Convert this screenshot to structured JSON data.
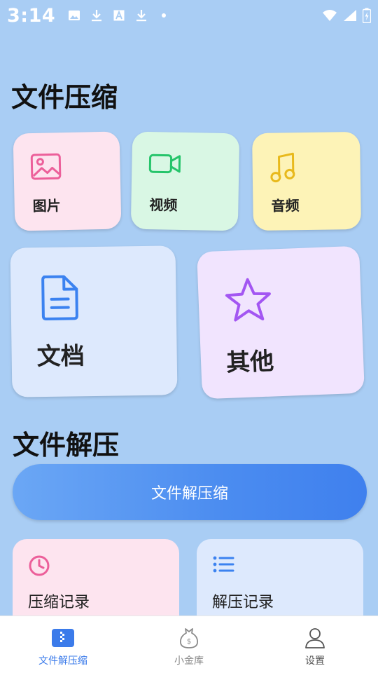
{
  "status_bar": {
    "time": "3:14",
    "icons": [
      "image-icon",
      "download-icon",
      "font-a-icon",
      "download-icon",
      "dot-icon"
    ],
    "right_icons": [
      "wifi-icon",
      "signal-icon",
      "battery-charging-icon"
    ]
  },
  "compress_section": {
    "title": "文件压缩",
    "cards": [
      {
        "label": "图片",
        "icon": "image-icon",
        "color": "#fde4ef",
        "icon_color": "#ec5f9a"
      },
      {
        "label": "视频",
        "icon": "video-icon",
        "color": "#d9f7e4",
        "icon_color": "#25c46a"
      },
      {
        "label": "音频",
        "icon": "music-icon",
        "color": "#fdf3b7",
        "icon_color": "#e8b91c"
      },
      {
        "label": "文档",
        "icon": "document-icon",
        "color": "#dde9fd",
        "icon_color": "#3b82f0"
      },
      {
        "label": "其他",
        "icon": "star-icon",
        "color": "#f1e4fe",
        "icon_color": "#a356f2"
      }
    ]
  },
  "decompress_section": {
    "title": "文件解压",
    "button_label": "文件解压缩"
  },
  "records": [
    {
      "label": "压缩记录",
      "icon": "clock-icon",
      "color": "#fde4ef",
      "icon_color": "#ec5f9a"
    },
    {
      "label": "解压记录",
      "icon": "list-icon",
      "color": "#dde9fd",
      "icon_color": "#3b82f0"
    }
  ],
  "bottom_nav": {
    "items": [
      {
        "label": "文件解压缩",
        "icon": "zip-file-icon",
        "active": true
      },
      {
        "label": "小金库",
        "icon": "money-bag-icon",
        "active": false
      },
      {
        "label": "设置",
        "icon": "user-icon",
        "active": false
      }
    ]
  },
  "colors": {
    "background": "#a9cdf4",
    "accent": "#3b7bea"
  }
}
